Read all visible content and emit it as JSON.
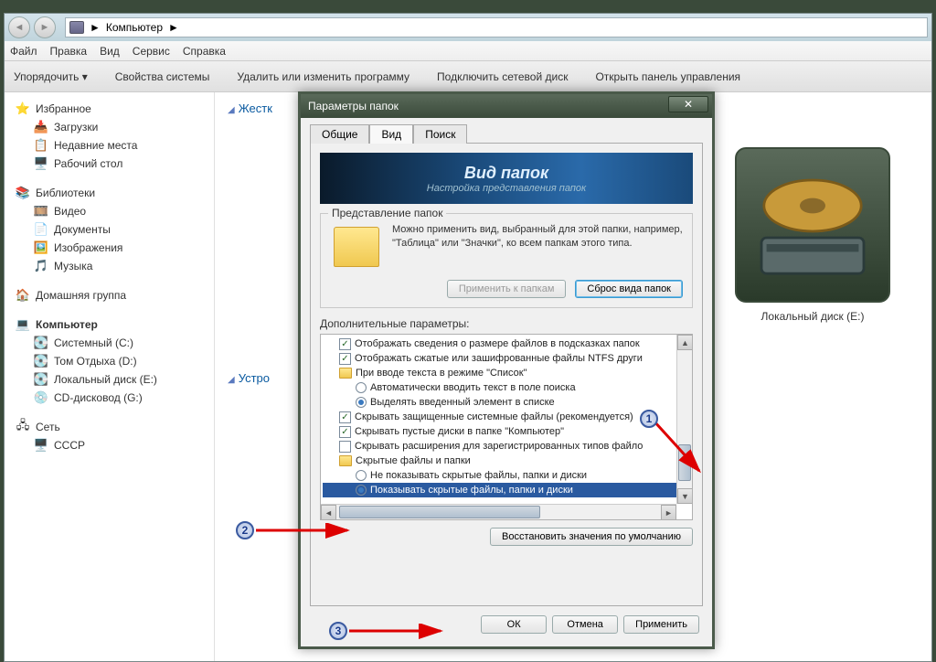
{
  "address": {
    "location": "Компьютер",
    "sep": "►"
  },
  "menu": [
    "Файл",
    "Правка",
    "Вид",
    "Сервис",
    "Справка"
  ],
  "toolbar": [
    "Упорядочить ▾",
    "Свойства системы",
    "Удалить или изменить программу",
    "Подключить сетевой диск",
    "Открыть панель управления"
  ],
  "sidebar": {
    "favorites": {
      "title": "Избранное",
      "items": [
        "Загрузки",
        "Недавние места",
        "Рабочий стол"
      ]
    },
    "libraries": {
      "title": "Библиотеки",
      "items": [
        "Видео",
        "Документы",
        "Изображения",
        "Музыка"
      ]
    },
    "homegroup": {
      "title": "Домашняя группа"
    },
    "computer": {
      "title": "Компьютер",
      "items": [
        "Системный (C:)",
        "Том Отдыха (D:)",
        "Локальный диск (E:)",
        "CD-дисковод (G:)"
      ]
    },
    "network": {
      "title": "Сеть",
      "items": [
        "СССР"
      ]
    }
  },
  "main": {
    "section1": "Жестк",
    "section2": "Устро",
    "drive_label": "Локальный диск (E:)"
  },
  "dialog": {
    "title": "Параметры папок",
    "tabs": [
      "Общие",
      "Вид",
      "Поиск"
    ],
    "active_tab": "Вид",
    "banner": {
      "title": "Вид папок",
      "subtitle": "Настройка представления папок"
    },
    "group": {
      "title": "Представление папок",
      "text": "Можно применить вид, выбранный для этой папки, например, \"Таблица\" или \"Значки\", ко всем папкам этого типа.",
      "apply": "Применить к папкам",
      "reset": "Сброс вида папок"
    },
    "adv_label": "Дополнительные параметры:",
    "tree": [
      {
        "type": "check",
        "on": true,
        "text": "Отображать сведения о размере файлов в подсказках папок"
      },
      {
        "type": "check",
        "on": true,
        "text": "Отображать сжатые или зашифрованные файлы NTFS други"
      },
      {
        "type": "folder",
        "text": "При вводе текста в режиме \"Список\""
      },
      {
        "type": "radio",
        "on": false,
        "indent": 2,
        "text": "Автоматически вводить текст в поле поиска"
      },
      {
        "type": "radio",
        "on": true,
        "indent": 2,
        "text": "Выделять введенный элемент в списке"
      },
      {
        "type": "check",
        "on": true,
        "text": "Скрывать защищенные системные файлы (рекомендуется)"
      },
      {
        "type": "check",
        "on": true,
        "text": "Скрывать пустые диски в папке \"Компьютер\""
      },
      {
        "type": "check",
        "on": false,
        "text": "Скрывать расширения для зарегистрированных типов файло"
      },
      {
        "type": "folder",
        "text": "Скрытые файлы и папки"
      },
      {
        "type": "radio",
        "on": false,
        "indent": 2,
        "text": "Не показывать скрытые файлы, папки и диски"
      },
      {
        "type": "radio",
        "on": true,
        "indent": 2,
        "selected": true,
        "text": "Показывать скрытые файлы, папки и диски"
      }
    ],
    "restore": "Восстановить значения по умолчанию",
    "ok": "ОК",
    "cancel": "Отмена",
    "apply": "Применить"
  },
  "callouts": {
    "1": "1",
    "2": "2",
    "3": "3"
  }
}
